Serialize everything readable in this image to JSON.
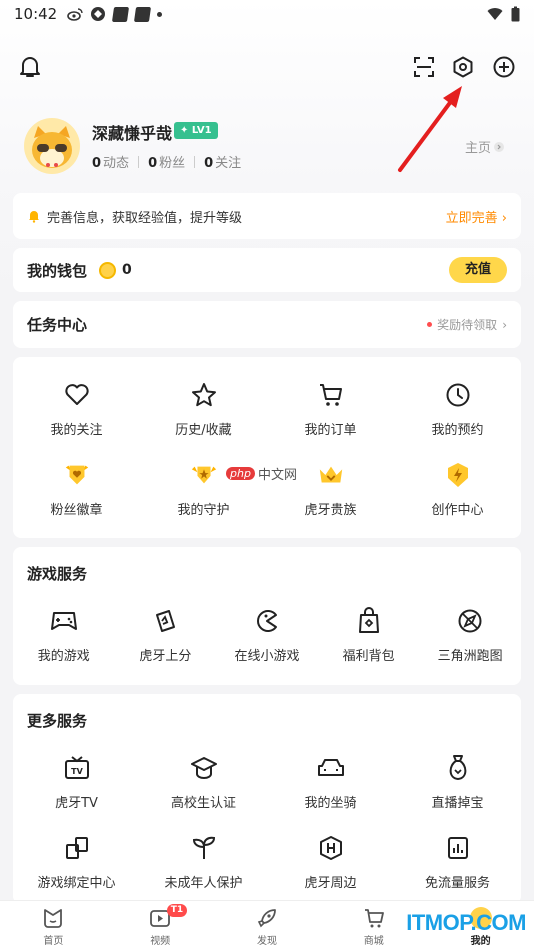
{
  "status_bar": {
    "time": "10:42"
  },
  "profile": {
    "username": "深藏慊乎哉",
    "level": "LV1",
    "stats": [
      {
        "count": "0",
        "label": "动态"
      },
      {
        "count": "0",
        "label": "粉丝"
      },
      {
        "count": "0",
        "label": "关注"
      }
    ],
    "homepage_label": "主页"
  },
  "notice": {
    "text": "完善信息，获取经验值，提升等级",
    "cta": "立即完善"
  },
  "wallet": {
    "title": "我的钱包",
    "balance": "0",
    "recharge": "充值"
  },
  "tasks": {
    "title": "任务中心",
    "reward": "奖励待领取"
  },
  "quick_grid": [
    {
      "label": "我的关注",
      "icon": "heart-icon"
    },
    {
      "label": "历史/收藏",
      "icon": "star-icon"
    },
    {
      "label": "我的订单",
      "icon": "cart-icon"
    },
    {
      "label": "我的预约",
      "icon": "clock-icon"
    },
    {
      "label": "粉丝徽章",
      "icon": "fan-badge-icon"
    },
    {
      "label": "我的守护",
      "icon": "guard-icon"
    },
    {
      "label": "虎牙贵族",
      "icon": "crown-icon"
    },
    {
      "label": "创作中心",
      "icon": "lightning-icon"
    }
  ],
  "game_services": {
    "title": "游戏服务",
    "items": [
      {
        "label": "我的游戏",
        "icon": "gamepad-icon"
      },
      {
        "label": "虎牙上分",
        "icon": "rank-up-icon"
      },
      {
        "label": "在线小游戏",
        "icon": "pacman-icon"
      },
      {
        "label": "福利背包",
        "icon": "bag-icon"
      },
      {
        "label": "三角洲跑图",
        "icon": "compass-icon"
      }
    ]
  },
  "more_services": {
    "title": "更多服务",
    "items": [
      {
        "label": "虎牙TV",
        "icon": "tv-icon"
      },
      {
        "label": "高校生认证",
        "icon": "graduation-cap-icon"
      },
      {
        "label": "我的坐骑",
        "icon": "car-icon"
      },
      {
        "label": "直播掉宝",
        "icon": "treasure-bag-icon"
      },
      {
        "label": "游戏绑定中心",
        "icon": "bind-icon"
      },
      {
        "label": "未成年人保护",
        "icon": "sprout-icon"
      },
      {
        "label": "虎牙周边",
        "icon": "merch-icon"
      },
      {
        "label": "免流量服务",
        "icon": "data-free-icon"
      }
    ]
  },
  "bottom_nav": [
    {
      "label": "首页",
      "icon": "home-icon"
    },
    {
      "label": "视频",
      "icon": "video-icon",
      "badge": "T1"
    },
    {
      "label": "发现",
      "icon": "rocket-icon"
    },
    {
      "label": "商城",
      "icon": "shop-cart-icon"
    },
    {
      "label": "我的",
      "icon": "me-icon"
    }
  ],
  "watermarks": {
    "php": "php",
    "php_cn": "中文网",
    "itmop": "ITMOP.COM"
  },
  "colors": {
    "accent": "#ffd74a",
    "cta": "#ff8a00",
    "level": "#36c08f",
    "arrow": "#e41f1f"
  }
}
